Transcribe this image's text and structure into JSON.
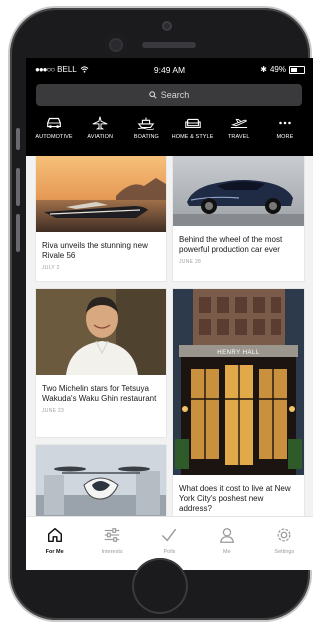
{
  "status": {
    "carrier": "BELL",
    "time": "9:49 AM",
    "battery": "49%"
  },
  "search": {
    "placeholder": "Search"
  },
  "categories": [
    {
      "label": "AUTOMOTIVE",
      "icon": "car-icon"
    },
    {
      "label": "AVIATION",
      "icon": "plane-icon"
    },
    {
      "label": "BOATING",
      "icon": "boat-icon"
    },
    {
      "label": "HOME & STYLE",
      "icon": "sofa-icon"
    },
    {
      "label": "TRAVEL",
      "icon": "airplane-takeoff-icon"
    },
    {
      "label": "MORE",
      "icon": "more-dots-icon"
    }
  ],
  "articles": [
    {
      "title": "Riva unveils the stunning new Rivale 56",
      "date": "JULY 2"
    },
    {
      "title": "Behind the wheel of the most powerful production car ever",
      "date": "JUNE 28"
    },
    {
      "title": "Two Michelin stars for Tetsuya Wakuda's Waku Ghin restaurant",
      "date": "JUNE 23"
    },
    {
      "title": "What does it cost to live at New York City's poshest new address?",
      "date": "",
      "sign": "HENRY HALL"
    }
  ],
  "tabs": [
    {
      "label": "For Me",
      "icon": "home-icon",
      "active": true
    },
    {
      "label": "Interests",
      "icon": "sliders-icon",
      "active": false
    },
    {
      "label": "Polls",
      "icon": "check-icon",
      "active": false
    },
    {
      "label": "Me",
      "icon": "user-icon",
      "active": false
    },
    {
      "label": "Settings",
      "icon": "gear-icon",
      "active": false
    }
  ]
}
